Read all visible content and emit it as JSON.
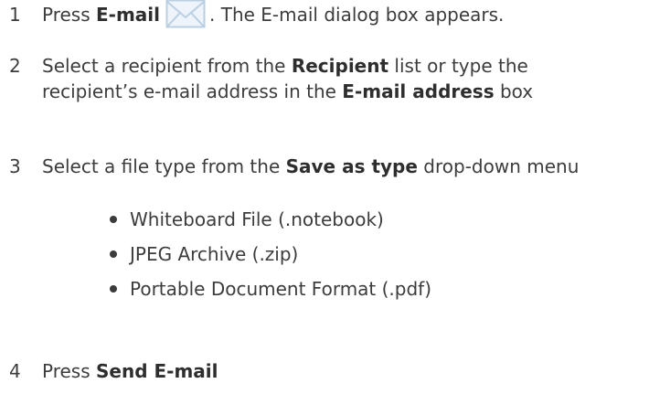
{
  "steps": [
    {
      "number": "1",
      "parts": {
        "a": "Press ",
        "b": "E-mail",
        "c": ". The E-mail dialog box appears."
      },
      "icon": "envelope-icon"
    },
    {
      "number": "2",
      "parts": {
        "a": "Select a recipient from the ",
        "b": "Recipient",
        "c": " list or type the recipient’s e-mail address in the ",
        "d": "E-mail address",
        "e": " box"
      }
    },
    {
      "number": "3",
      "parts": {
        "a": "Select a file type from the ",
        "b": "Save as type",
        "c": " drop-down menu"
      }
    },
    {
      "number": "4",
      "parts": {
        "a": "Press ",
        "b": "Send E-mail"
      }
    }
  ],
  "file_types": [
    "Whiteboard File (.notebook)",
    "JPEG Archive (.zip)",
    "Portable Document Format (.pdf)"
  ],
  "colors": {
    "text": "#3c3c3c",
    "icon_border": "#b9cfe4",
    "icon_fill": "#eef4fa"
  }
}
